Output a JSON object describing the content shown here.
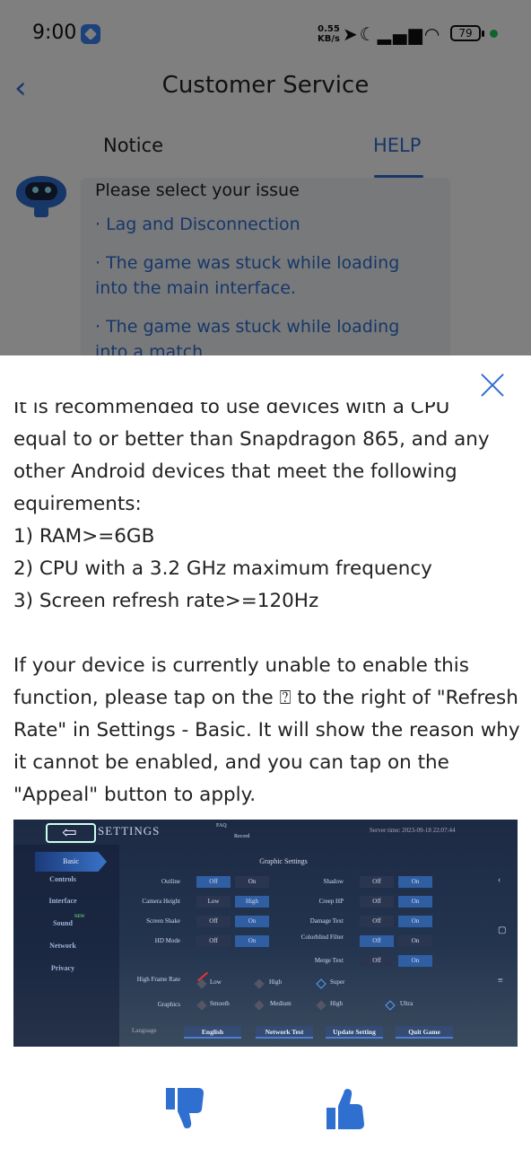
{
  "status_bar": {
    "time": "9:00",
    "net_speed_value": "0.55",
    "net_speed_unit": "KB/s",
    "battery": "79",
    "icons": [
      "location-arrow-icon",
      "moon-icon",
      "signal-icon",
      "wifi-icon"
    ]
  },
  "header": {
    "title": "Customer Service",
    "tabs": [
      {
        "label": "Notice",
        "active": false
      },
      {
        "label": "HELP",
        "active": true
      }
    ]
  },
  "chat": {
    "prompt": "Please select your issue",
    "items": [
      "· Lag and Disconnection",
      "· The game was stuck while loading into the main interface.",
      "· The game was stuck while loading into a match"
    ]
  },
  "sheet": {
    "partial_line": "It is recommended to use devices with a CPU",
    "intro": "equal to or better than Snapdragon 865, and any other Android devices that meet the following equirements:",
    "requirements": [
      "1) RAM>=6GB",
      "2) CPU with a 3.2 GHz maximum frequency",
      "3) Screen refresh rate>=120Hz"
    ],
    "appeal_text": "If your device is currently unable to enable this function, please tap on the ⍰ to the right of \"Refresh Rate\" in Settings - Basic. It will show the reason why it cannot be enabled, and you can tap on the \"Appeal\" button to apply."
  },
  "game_screenshot": {
    "title": "SETTINGS",
    "faq_labels": [
      "FAQ",
      "Record"
    ],
    "server_time": "Server time: 2023-09-18 22:07:44",
    "nav": [
      "Basic",
      "Controls",
      "Interface",
      "Sound",
      "Network",
      "Privacy"
    ],
    "new_badge": "NEW",
    "section": "Graphic Settings",
    "rows_left": [
      {
        "label": "Outline",
        "a": "Off",
        "b": "On",
        "selected": "a"
      },
      {
        "label": "Camera Height",
        "a": "Low",
        "b": "High",
        "selected": "b"
      },
      {
        "label": "Screen Shake",
        "a": "Off",
        "b": "On",
        "selected": "b"
      },
      {
        "label": "HD Mode",
        "a": "Off",
        "b": "On",
        "selected": "b"
      }
    ],
    "rows_right": [
      {
        "label": "Shadow",
        "a": "Off",
        "b": "On",
        "selected": "b"
      },
      {
        "label": "Creep HP",
        "a": "Off",
        "b": "On",
        "selected": "b"
      },
      {
        "label": "Damage Text",
        "a": "Off",
        "b": "On",
        "selected": "b"
      },
      {
        "label": "Colorblind Filter",
        "a": "Off",
        "b": "On",
        "selected": "a"
      },
      {
        "label": "Merge Text",
        "a": "Off",
        "b": "On",
        "selected": "b"
      }
    ],
    "frame_rate": {
      "label": "High Frame Rate",
      "options": [
        "Low",
        "High",
        "Super"
      ]
    },
    "graphics": {
      "label": "Graphics",
      "options": [
        "Smooth",
        "Medium",
        "High",
        "Ultra"
      ]
    },
    "language_label": "Language",
    "buttons": [
      "English",
      "Network Test",
      "Update Setting",
      "Quit Game"
    ]
  },
  "feedback": {
    "icons": [
      "thumbs-down-icon",
      "thumbs-up-icon"
    ],
    "accent": "#2f6fd0"
  },
  "colors": {
    "accent": "#2f6fd0",
    "overlay": "rgba(0,0,0,0.5)"
  }
}
